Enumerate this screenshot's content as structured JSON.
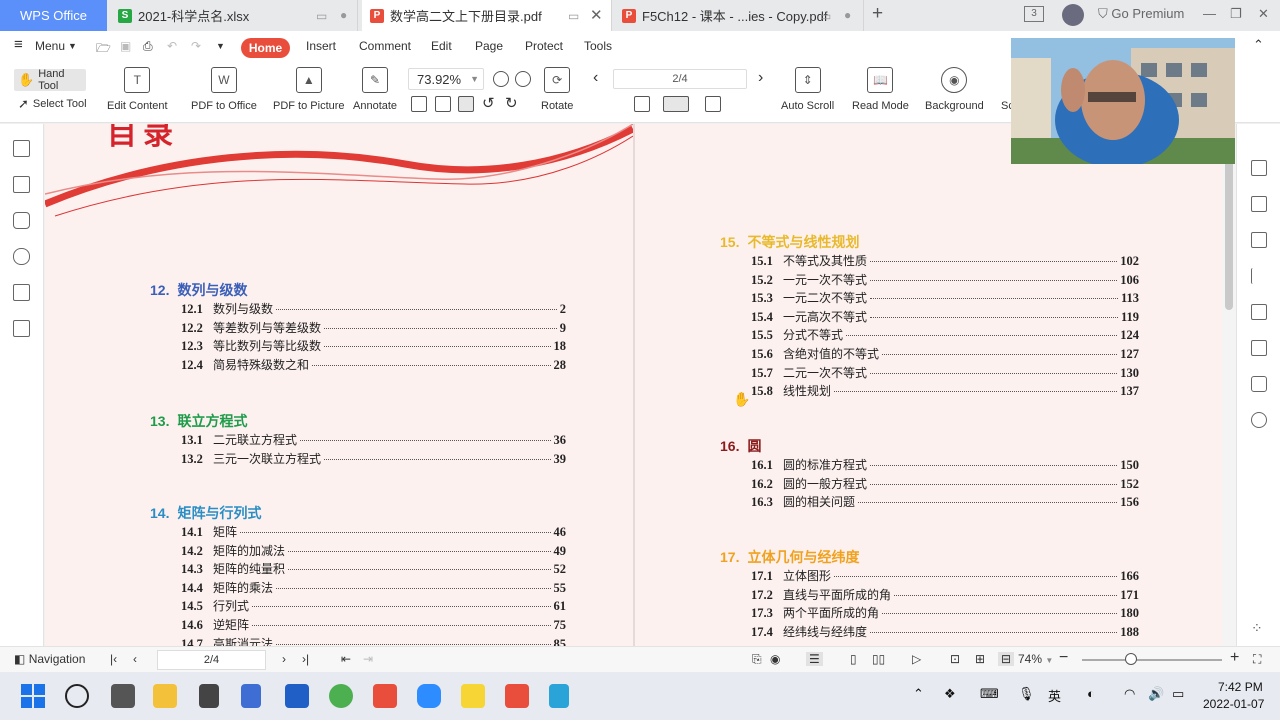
{
  "tabs": {
    "app_label": "WPS Office",
    "items": [
      {
        "label": "2021-科学点名.xlsx",
        "icon": "S",
        "color": "#28a745"
      },
      {
        "label": "数学高二文上下册目录.pdf",
        "icon": "P",
        "color": "#e94e3c"
      },
      {
        "label": "F5Ch12 - 课本 - ...ies - Copy.pdf",
        "icon": "P",
        "color": "#e94e3c"
      }
    ],
    "add_label": "+",
    "badge": "3",
    "premium_label": "Go Premium"
  },
  "menu": {
    "menu_label": "Menu",
    "items": [
      "Home",
      "Insert",
      "Comment",
      "Edit",
      "Page",
      "Protect",
      "Tools"
    ]
  },
  "toolbar": {
    "hand_tool": "Hand Tool",
    "select_tool": "Select Tool",
    "edit_content": "Edit Content",
    "pdf_to_office": "PDF to Office",
    "pdf_to_picture": "PDF to Picture",
    "annotate": "Annotate",
    "zoom_value": "73.92%",
    "rotate": "Rotate",
    "page_value": "2/4",
    "auto_scroll": "Auto Scroll",
    "read_mode": "Read Mode",
    "background": "Background",
    "cut_label": "Sc"
  },
  "doc": {
    "left_heading": "目录",
    "left_sections": [
      {
        "num": "12.",
        "title": "数列与级数",
        "color": "#3b5fb8",
        "entries": [
          {
            "num": "12.1",
            "title": "数列与级数",
            "page": "2"
          },
          {
            "num": "12.2",
            "title": "等差数列与等差级数",
            "page": "9"
          },
          {
            "num": "12.3",
            "title": "等比数列与等比级数",
            "page": "18"
          },
          {
            "num": "12.4",
            "title": "简易特殊级数之和",
            "page": "28"
          }
        ]
      },
      {
        "num": "13.",
        "title": "联立方程式",
        "color": "#1e9c4a",
        "entries": [
          {
            "num": "13.1",
            "title": "二元联立方程式",
            "page": "36"
          },
          {
            "num": "13.2",
            "title": "三元一次联立方程式",
            "page": "39"
          }
        ]
      },
      {
        "num": "14.",
        "title": "矩阵与行列式",
        "color": "#2a8ec4",
        "entries": [
          {
            "num": "14.1",
            "title": "矩阵",
            "page": "46"
          },
          {
            "num": "14.2",
            "title": "矩阵的加减法",
            "page": "49"
          },
          {
            "num": "14.3",
            "title": "矩阵的纯量积",
            "page": "52"
          },
          {
            "num": "14.4",
            "title": "矩阵的乘法",
            "page": "55"
          },
          {
            "num": "14.5",
            "title": "行列式",
            "page": "61"
          },
          {
            "num": "14.6",
            "title": "逆矩阵",
            "page": "75"
          },
          {
            "num": "14.7",
            "title": "高斯消元法",
            "page": "85"
          }
        ]
      }
    ],
    "right_sections": [
      {
        "num": "15.",
        "title": "不等式与线性规划",
        "color": "#e8b92a",
        "entries": [
          {
            "num": "15.1",
            "title": "不等式及其性质",
            "page": "102"
          },
          {
            "num": "15.2",
            "title": "一元一次不等式",
            "page": "106"
          },
          {
            "num": "15.3",
            "title": "一元二次不等式",
            "page": "113"
          },
          {
            "num": "15.4",
            "title": "一元高次不等式",
            "page": "119"
          },
          {
            "num": "15.5",
            "title": "分式不等式",
            "page": "124"
          },
          {
            "num": "15.6",
            "title": "含绝对值的不等式",
            "page": "127"
          },
          {
            "num": "15.7",
            "title": "二元一次不等式",
            "page": "130"
          },
          {
            "num": "15.8",
            "title": "线性规划",
            "page": "137"
          }
        ]
      },
      {
        "num": "16.",
        "title": "圆",
        "color": "#8a1c1c",
        "entries": [
          {
            "num": "16.1",
            "title": "圆的标准方程式",
            "page": "150"
          },
          {
            "num": "16.2",
            "title": "圆的一般方程式",
            "page": "152"
          },
          {
            "num": "16.3",
            "title": "圆的相关问题",
            "page": "156"
          }
        ]
      },
      {
        "num": "17.",
        "title": "立体几何与经纬度",
        "color": "#f0a21e",
        "entries": [
          {
            "num": "17.1",
            "title": "立体图形",
            "page": "166"
          },
          {
            "num": "17.2",
            "title": "直线与平面所成的角",
            "page": "171"
          },
          {
            "num": "17.3",
            "title": "两个平面所成的角",
            "page": "180"
          },
          {
            "num": "17.4",
            "title": "经纬线与经纬度",
            "page": "188"
          }
        ]
      }
    ]
  },
  "status": {
    "navigation": "Navigation",
    "page_value": "2/4",
    "zoom": "74%"
  },
  "taskbar": {
    "ime": "英",
    "time": "7:42 PM",
    "date": "2022-01-07"
  }
}
